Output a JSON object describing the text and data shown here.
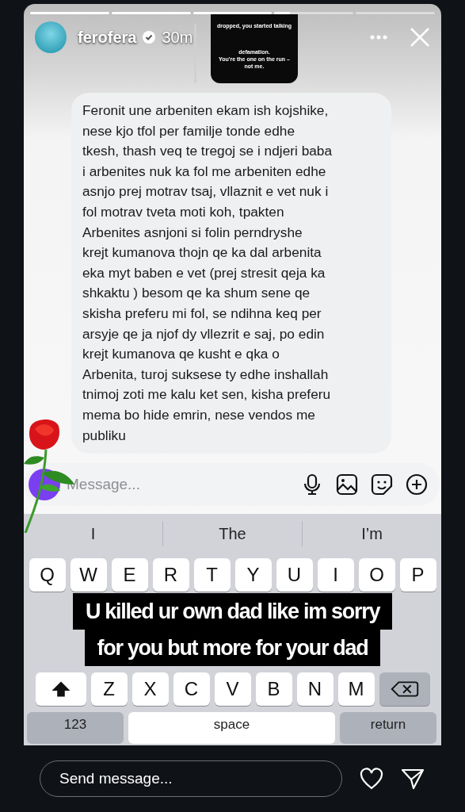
{
  "story": {
    "progress": [
      {
        "level": 1
      },
      {
        "level": 1
      },
      {
        "level": 1
      },
      {
        "level": 0.2
      }
    ],
    "username": "ferofera",
    "verified": true,
    "time": "30m"
  },
  "shared_post": {
    "lines": [
      "dropped, you started talking",
      "defamation.",
      "You're the one on the run – not me."
    ]
  },
  "message": {
    "text": "Feronit une arbeniten ekam ish kojshike,\nnese kjo tfol per familje tonde edhe\ntkesh, thash veq te tregoj se i ndjeri baba\ni arbenites nuk ka fol me arbeniten edhe\nasnjo prej motrav tsaj, vllaznit e vet nuk i\nfol motrav tveta moti koh, tpakten\nArbenites asnjoni si folin perndryshe\nkrejt kumanova thojn qe ka dal arbenita\neka myt baben e vet (prej stresit qeja ka\nshkaktu ) besom qe ka shum sene qe\nskisha preferu mi fol, se ndihna keq per\narsyje qe ja njof dy vllezrit e saj, po edin\nkrejt kumanova qe kusht e qka o\nArbenita, turoj suksese ty edhe inshallah\ntnimoj zoti me kalu ket sen, kisha preferu\nmema bo hide emrin, nese vendos me\npubliku"
  },
  "composer": {
    "placeholder": "Message..."
  },
  "keyboard": {
    "suggestions": [
      "I",
      "The",
      "I’m"
    ],
    "top_row": [
      "Q",
      "W",
      "E",
      "R",
      "T",
      "Y",
      "U",
      "I",
      "O",
      "P"
    ],
    "bottom_letters": [
      "Z",
      "X",
      "C",
      "V",
      "B",
      "N",
      "M"
    ],
    "bottom_row": [
      "123",
      "space",
      "return"
    ]
  },
  "caption": {
    "lines": [
      "U killed ur own dad like im sorry",
      "for you but more for your dad"
    ]
  },
  "reply_bar": {
    "placeholder": "Send message..."
  }
}
